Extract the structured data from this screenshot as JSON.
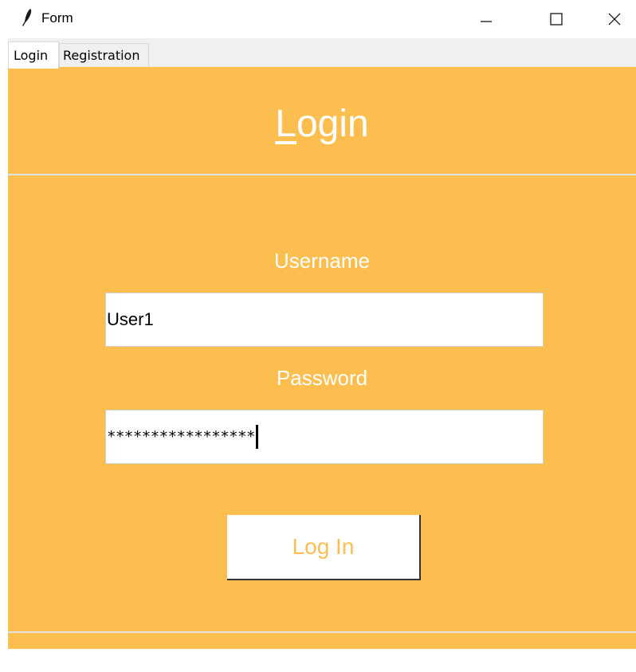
{
  "window": {
    "title": "Form",
    "icon": "feather-icon",
    "controls": {
      "minimize_icon": "minimize-icon",
      "maximize_icon": "maximize-icon",
      "close_icon": "close-icon"
    }
  },
  "tabs": [
    {
      "label": "Login",
      "active": true
    },
    {
      "label": "Registration",
      "active": false
    }
  ],
  "login": {
    "heading": "Login",
    "username_label": "Username",
    "username_value": "User1",
    "password_label": "Password",
    "password_value": "*****************",
    "button_label": "Log In"
  },
  "colors": {
    "panel_background": "#fcbe4f",
    "label_text": "#ffffff",
    "button_text": "#fcbe4f"
  }
}
